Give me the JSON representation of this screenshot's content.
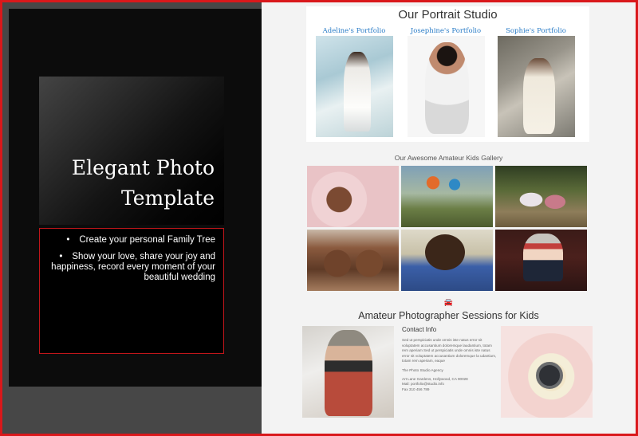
{
  "left": {
    "title_line1": "Elegant Photo",
    "title_line2": "Template",
    "bullets": [
      "Create your personal Family Tree",
      "Show your love, share your joy and happiness, record every moment of your beautiful wedding"
    ],
    "bullet_symbol": "•"
  },
  "studio": {
    "title": "Our Portrait Studio",
    "portfolios": [
      "Adeline's Portfolio",
      "Josephine's Portfolio",
      "Sophie's Portfolio"
    ]
  },
  "kids": {
    "title": "Our Awesome Amateur Kids Gallery"
  },
  "sessions": {
    "icon": "car-icon",
    "icon_glyph": "🚘",
    "title": "Amateur Photographer Sessions for Kids",
    "contact_title": "Contact Info",
    "contact_body": "Sed ut perspiciatis unde omnis iste natus error sit voluptatem accusantium doloremque laudantium, totam rem aperiam Sed ut perspiciatis unde omnis iste natus error sit voluptatem accusantium doloremque la udantium, totam rem aperiam, eaque",
    "agency": "The Photo Studio Agency",
    "address": "Art Lane Gardens, Hollywood, CA 90028",
    "mail": "Mail: portfolio@studio.info",
    "fax": "Fax 310 456 789"
  },
  "colors": {
    "frame_border": "#d9181b",
    "link": "#2a7cc7",
    "dark_panel": "#0c0c0c"
  }
}
